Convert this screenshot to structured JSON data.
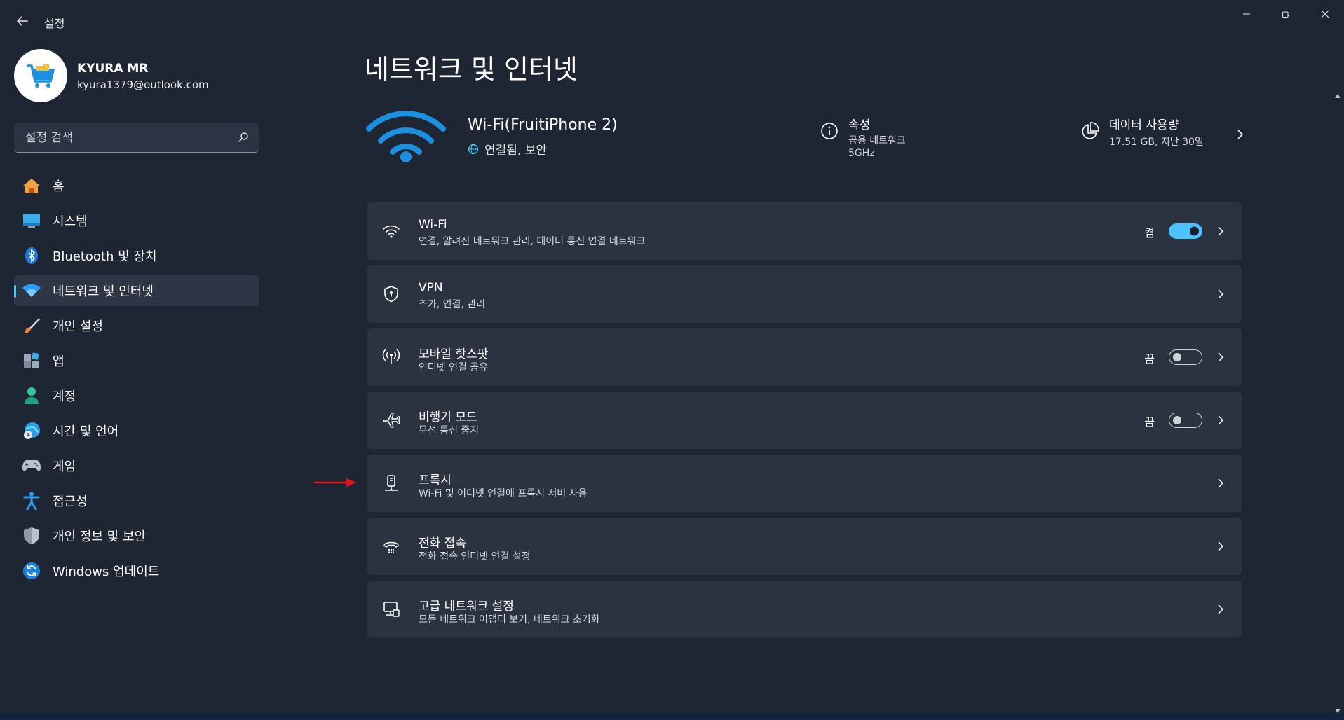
{
  "window": {
    "title": "설정",
    "controls": [
      "minimize-icon",
      "restore-icon",
      "close-icon"
    ]
  },
  "profile": {
    "name": "KYURA MR",
    "email": "kyura1379@outlook.com"
  },
  "search": {
    "placeholder": "설정 검색"
  },
  "sidebar": {
    "items": [
      {
        "label": "홈",
        "icon": "home-icon"
      },
      {
        "label": "시스템",
        "icon": "system-icon"
      },
      {
        "label": "Bluetooth 및 장치",
        "icon": "bluetooth-icon"
      },
      {
        "label": "네트워크 및 인터넷",
        "icon": "network-icon",
        "active": true
      },
      {
        "label": "개인 설정",
        "icon": "brush-icon"
      },
      {
        "label": "앱",
        "icon": "apps-icon"
      },
      {
        "label": "계정",
        "icon": "account-icon"
      },
      {
        "label": "시간 및 언어",
        "icon": "time-language-icon"
      },
      {
        "label": "게임",
        "icon": "gamepad-icon"
      },
      {
        "label": "접근성",
        "icon": "accessibility-icon"
      },
      {
        "label": "개인 정보 및 보안",
        "icon": "shield-icon"
      },
      {
        "label": "Windows 업데이트",
        "icon": "update-icon"
      }
    ]
  },
  "main": {
    "title": "네트워크 및 인터넷",
    "connection": {
      "name": "Wi-Fi(FruitiPhone 2)",
      "status": "연결됨, 보안"
    },
    "properties": {
      "title": "속성",
      "line1": "공용 네트워크",
      "line2": "5GHz"
    },
    "data_usage": {
      "title": "데이터 사용량",
      "value": "17.51 GB, 지난 30일"
    },
    "cards": [
      {
        "title": "Wi-Fi",
        "subtitle": "연결, 알려진 네트워크 관리, 데이터 통신 연결 네트워크",
        "toggle_label": "켬",
        "toggle_on": true
      },
      {
        "title": "VPN",
        "subtitle": "추가, 연결, 관리"
      },
      {
        "title": "모바일 핫스팟",
        "subtitle": "인터넷 연결 공유",
        "toggle_label": "끔",
        "toggle_on": false
      },
      {
        "title": "비행기 모드",
        "subtitle": "무선 통신 중지",
        "toggle_label": "끔",
        "toggle_on": false
      },
      {
        "title": "프록시",
        "subtitle": "Wi-Fi 및 이더넷 연결에 프록시 서버 사용"
      },
      {
        "title": "전화 접속",
        "subtitle": "전화 접속 인터넷 연결 설정"
      },
      {
        "title": "고급 네트워크 설정",
        "subtitle": "모든 네트워크 어댑터 보기, 네트워크 초기화"
      }
    ]
  },
  "colors": {
    "background": "#1f2633",
    "card": "#2b3240",
    "accent": "#4cc2ff",
    "hero_wifi": "#1b8fe0",
    "annotation_arrow": "#e5121a"
  }
}
